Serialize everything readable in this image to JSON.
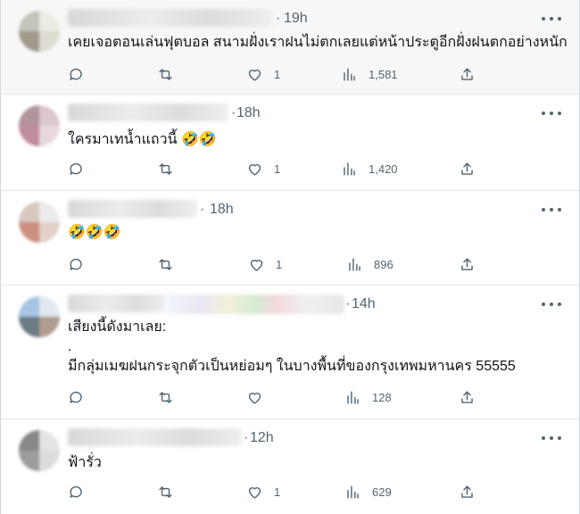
{
  "replies": [
    {
      "time": "19h",
      "text": [
        "เคยเจอตอนเล่นฟุตบอล สนามฝั่งเราฝนไม่ตกเลยแต่หน้าประตูอีกฝั่งฝนตกอย่างหนัก"
      ],
      "likes": "1",
      "views": "1,581",
      "avatar": [
        "#c4c4bc",
        "#ecece4",
        "#a09a8c",
        "#dcdcd0"
      ]
    },
    {
      "time": "18h",
      "text": [
        "ใครมาเทน้ำแถวนี้ 🤣🤣"
      ],
      "likes": "1",
      "views": "1,420",
      "avatar": [
        "#b0949a",
        "#dcc8cc",
        "#c08ca0",
        "#e8d8dc"
      ]
    },
    {
      "time": "18h",
      "text": [
        "🤣🤣🤣"
      ],
      "likes": "1",
      "views": "896",
      "avatar": [
        "#d8c8c0",
        "#ececec",
        "#cc9080",
        "#e4d0c8"
      ]
    },
    {
      "time": "14h",
      "text": [
        "เสียงนี้ดังมาเลย:",
        ".",
        "มีกลุ่มเมฆฝนกระจุกตัวเป็นหย่อมๆ ในบางพื้นที่ของกรุงเทพมหานคร 55555"
      ],
      "likes": "",
      "views": "128",
      "avatar": [
        "#a8c4e4",
        "#e0e8f0",
        "#6c7c84",
        "#b09c90"
      ]
    },
    {
      "time": "12h",
      "text": [
        "ฟ้ารั่ว"
      ],
      "likes": "1",
      "views": "629",
      "avatar": [
        "#88888a",
        "#e4e4e4",
        "#9c9c9c",
        "#dcdcdc"
      ]
    }
  ]
}
